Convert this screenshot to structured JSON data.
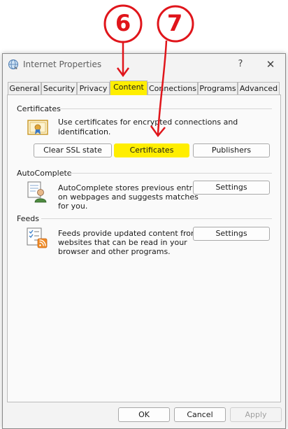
{
  "annotations": {
    "step_6": "6",
    "step_7": "7"
  },
  "window": {
    "title": "Internet Properties",
    "help": "?",
    "close": "✕"
  },
  "tabs": [
    {
      "label": "General"
    },
    {
      "label": "Security"
    },
    {
      "label": "Privacy"
    },
    {
      "label": "Content"
    },
    {
      "label": "Connections"
    },
    {
      "label": "Programs"
    },
    {
      "label": "Advanced"
    }
  ],
  "certificates": {
    "heading": "Certificates",
    "description": "Use certificates for encrypted connections and identification.",
    "clear_ssl": "Clear SSL state",
    "certificates_btn": "Certificates",
    "publishers": "Publishers"
  },
  "autocomplete": {
    "heading": "AutoComplete",
    "line1": "AutoComplete stores previous entries",
    "line2": "on webpages and suggests matches",
    "line3": "for you.",
    "settings": "Settings"
  },
  "feeds": {
    "heading": "Feeds",
    "line1": "Feeds provide updated content from",
    "line2": "websites that can be read in your",
    "line3": "browser and other programs.",
    "settings": "Settings"
  },
  "footer": {
    "ok": "OK",
    "cancel": "Cancel",
    "apply": "Apply"
  },
  "colors": {
    "highlight": "#ffee00",
    "annotation": "#e0151b"
  }
}
